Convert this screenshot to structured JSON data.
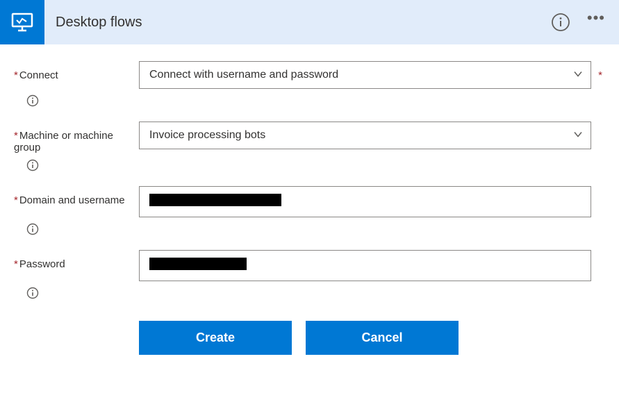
{
  "header": {
    "title": "Desktop flows"
  },
  "fields": {
    "connect": {
      "label": "Connect",
      "value": "Connect with username and password",
      "required": true,
      "trailingRequired": true
    },
    "machine": {
      "label": "Machine or machine group",
      "value": "Invoice processing bots",
      "required": true
    },
    "domainUser": {
      "label": "Domain and username",
      "value": "████████████████",
      "redactedWidth": "190px",
      "required": true
    },
    "password": {
      "label": "Password",
      "value": "████████████",
      "redactedWidth": "140px",
      "required": true
    }
  },
  "buttons": {
    "create": "Create",
    "cancel": "Cancel"
  },
  "asterisk": "*"
}
